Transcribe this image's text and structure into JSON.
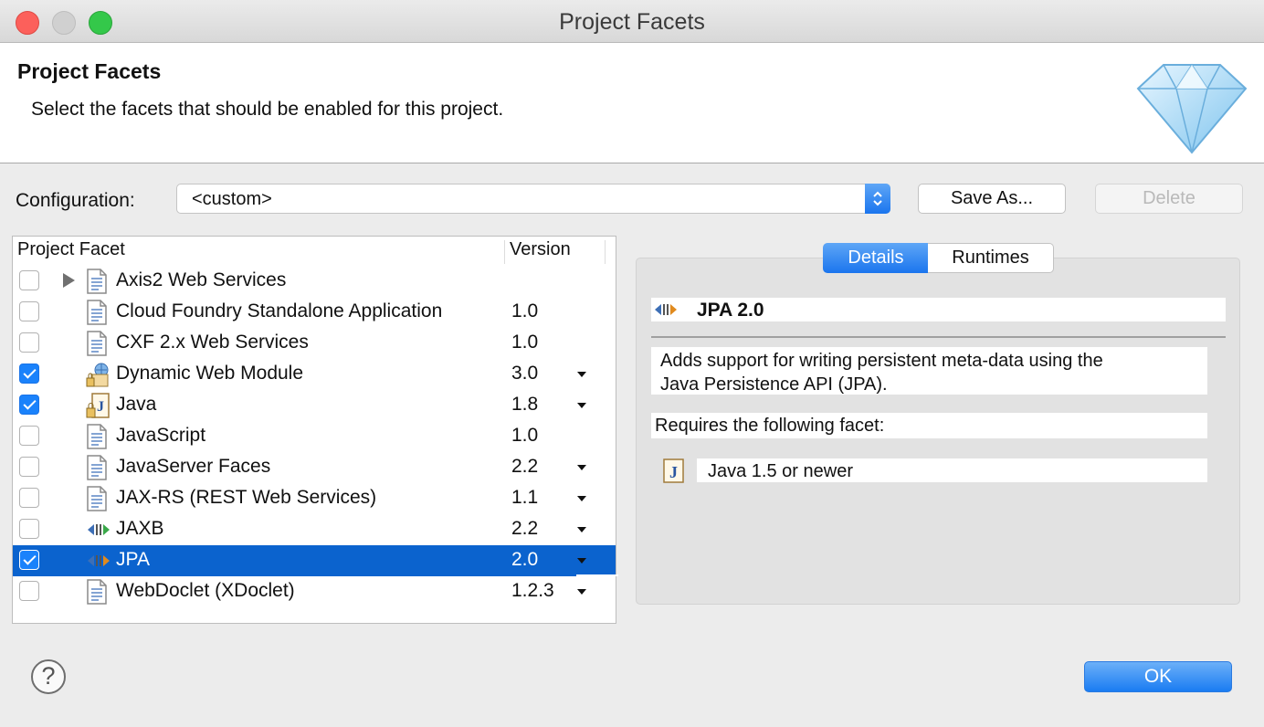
{
  "window": {
    "title": "Project Facets"
  },
  "banner": {
    "title": "Project Facets",
    "description": "Select the facets that should be enabled for this project.",
    "icon": "diamond-icon"
  },
  "configuration": {
    "label": "Configuration:",
    "value": "<custom>",
    "save_as_label": "Save As...",
    "delete_label": "Delete"
  },
  "table": {
    "col_facet": "Project Facet",
    "col_version": "Version",
    "rows": [
      {
        "name": "Axis2 Web Services",
        "version": "",
        "checked": false,
        "expandable": true,
        "icon": "document-icon",
        "dropdown": false
      },
      {
        "name": "Cloud Foundry Standalone Application",
        "version": "1.0",
        "checked": false,
        "icon": "document-icon",
        "dropdown": false
      },
      {
        "name": "CXF 2.x Web Services",
        "version": "1.0",
        "checked": false,
        "icon": "document-icon",
        "dropdown": false
      },
      {
        "name": "Dynamic Web Module",
        "version": "3.0",
        "checked": true,
        "icon": "web-module-locked-icon",
        "dropdown": true
      },
      {
        "name": "Java",
        "version": "1.8",
        "checked": true,
        "icon": "java-locked-icon",
        "dropdown": true
      },
      {
        "name": "JavaScript",
        "version": "1.0",
        "checked": false,
        "icon": "document-icon",
        "dropdown": false
      },
      {
        "name": "JavaServer Faces",
        "version": "2.2",
        "checked": false,
        "icon": "document-icon",
        "dropdown": true
      },
      {
        "name": "JAX-RS (REST Web Services)",
        "version": "1.1",
        "checked": false,
        "icon": "document-icon",
        "dropdown": true
      },
      {
        "name": "JAXB",
        "version": "2.2",
        "checked": false,
        "icon": "jaxb-icon",
        "dropdown": true
      },
      {
        "name": "JPA",
        "version": "2.0",
        "checked": true,
        "icon": "jpa-icon",
        "dropdown": true,
        "selected": true
      },
      {
        "name": "WebDoclet (XDoclet)",
        "version": "1.2.3",
        "checked": false,
        "icon": "document-icon",
        "dropdown": true
      }
    ]
  },
  "tabs": {
    "details": "Details",
    "runtimes": "Runtimes",
    "active": "Details"
  },
  "details": {
    "name": "JPA 2.0",
    "description_line1": "Adds support for writing persistent meta-data using the",
    "description_line2": "Java Persistence API (JPA).",
    "requires_label": "Requires the following facet:",
    "requirement": "Java 1.5 or newer"
  },
  "footer": {
    "help": "?",
    "ok_label": "OK"
  },
  "colors": {
    "selection": "#0b63ce",
    "accent": "#1a82fb"
  }
}
